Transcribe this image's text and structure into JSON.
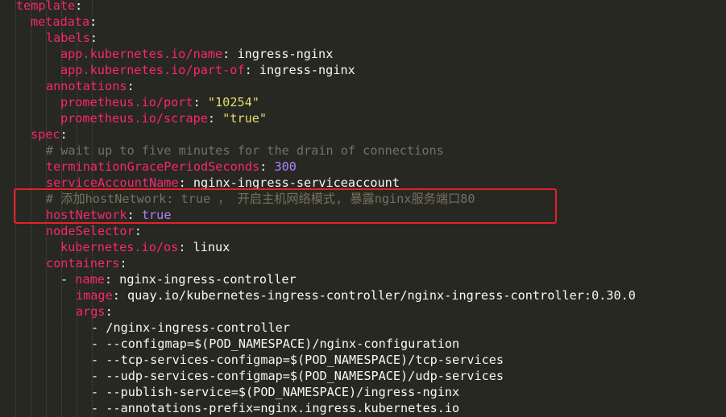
{
  "editor": {
    "colors": {
      "background": "#272822",
      "key": "#f92672",
      "string": "#e6db74",
      "number": "#ae81ff",
      "comment": "#75715e",
      "text": "#f8f8f2",
      "annotation_box": "#e8202a"
    },
    "lines": [
      {
        "key": "template",
        "sep": ":"
      },
      {
        "key": "metadata",
        "sep": ":"
      },
      {
        "key": "labels",
        "sep": ":"
      },
      {
        "key": "app.kubernetes.io/name",
        "sep": ": ",
        "value": "ingress-nginx"
      },
      {
        "key": "app.kubernetes.io/part-of",
        "sep": ": ",
        "value": "ingress-nginx"
      },
      {
        "key": "annotations",
        "sep": ":"
      },
      {
        "key": "prometheus.io/port",
        "sep": ": ",
        "value": "\"10254\""
      },
      {
        "key": "prometheus.io/scrape",
        "sep": ": ",
        "value": "\"true\""
      },
      {
        "key": "spec",
        "sep": ":"
      },
      {
        "comment": "# wait up to five minutes for the drain of connections"
      },
      {
        "key": "terminationGracePeriodSeconds",
        "sep": ": ",
        "value": "300"
      },
      {
        "key": "serviceAccountName",
        "sep": ": ",
        "value": "nginx-ingress-serviceaccount"
      },
      {
        "comment": "# 添加hostNetwork: true ， 开启主机网络模式, 暴露nginx服务端口80"
      },
      {
        "key": "hostNetwork",
        "sep": ": ",
        "value": "true"
      },
      {
        "key": "nodeSelector",
        "sep": ":"
      },
      {
        "key": "kubernetes.io/os",
        "sep": ": ",
        "value": "linux"
      },
      {
        "key": "containers",
        "sep": ":"
      },
      {
        "dash": "- ",
        "key": "name",
        "sep": ": ",
        "value": "nginx-ingress-controller"
      },
      {
        "key": "image",
        "sep": ": ",
        "value": "quay.io/kubernetes-ingress-controller/nginx-ingress-controller:0.30.0"
      },
      {
        "key": "args",
        "sep": ":"
      },
      {
        "dash": "- ",
        "value": "/nginx-ingress-controller"
      },
      {
        "dash": "- ",
        "value": "--configmap=$(POD_NAMESPACE)/nginx-configuration"
      },
      {
        "dash": "- ",
        "value": "--tcp-services-configmap=$(POD_NAMESPACE)/tcp-services"
      },
      {
        "dash": "- ",
        "value": "--udp-services-configmap=$(POD_NAMESPACE)/udp-services"
      },
      {
        "dash": "- ",
        "value": "--publish-service=$(POD_NAMESPACE)/ingress-nginx"
      },
      {
        "dash": "- ",
        "value": "--annotations-prefix=nginx.ingress.kubernetes.io"
      }
    ]
  }
}
